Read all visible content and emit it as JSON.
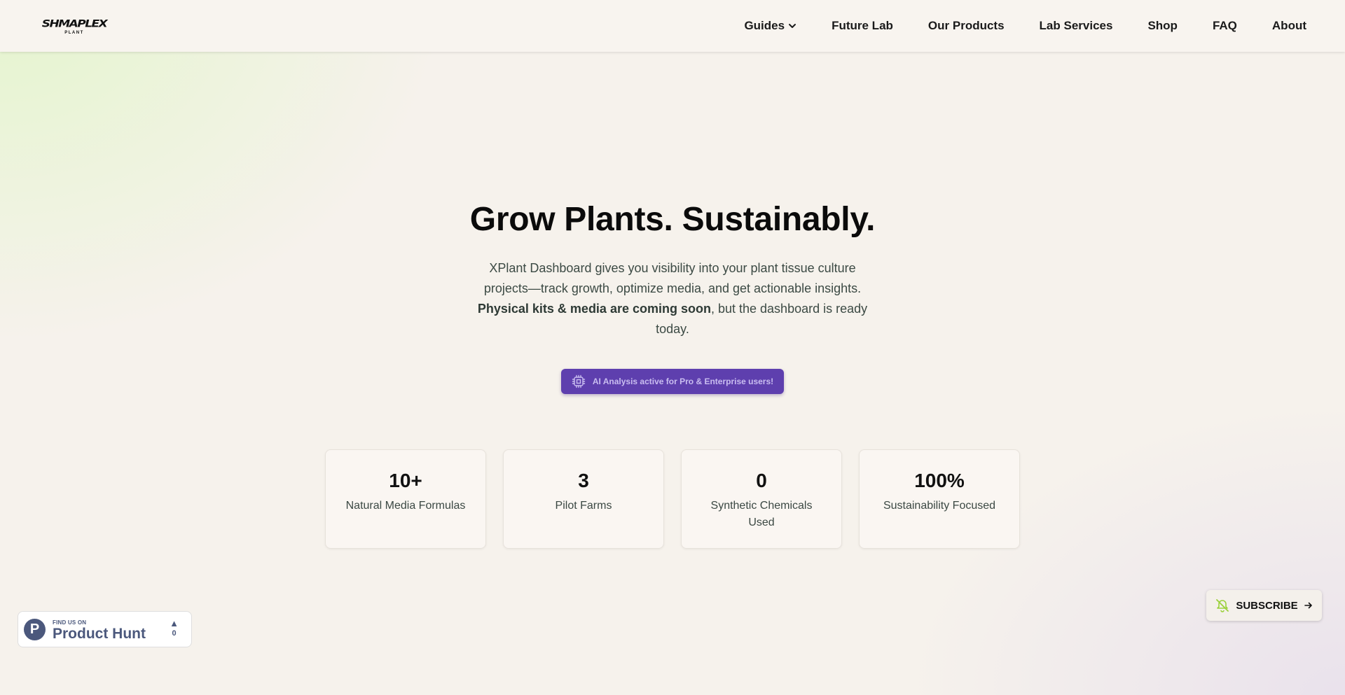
{
  "header": {
    "logo_text": "SHMAPLEX",
    "logo_subtext": "PLANT",
    "nav": [
      {
        "label": "Guides"
      },
      {
        "label": "Future Lab"
      },
      {
        "label": "Our Products"
      },
      {
        "label": "Lab Services"
      },
      {
        "label": "Shop"
      },
      {
        "label": "FAQ"
      },
      {
        "label": "About"
      }
    ]
  },
  "hero": {
    "title": "Grow Plants. Sustainably.",
    "desc_part1": "XPlant Dashboard gives you visibility into your plant tissue culture projects—track growth, optimize media, and get actionable insights. ",
    "desc_bold": "Physical kits & media are coming soon",
    "desc_part2": ", but the dashboard is ready today.",
    "ai_badge": "AI Analysis active for Pro & Enterprise users!"
  },
  "stats": [
    {
      "value": "10+",
      "label": "Natural Media Formulas"
    },
    {
      "value": "3",
      "label": "Pilot Farms"
    },
    {
      "value": "0",
      "label": "Synthetic Chemicals Used"
    },
    {
      "value": "100%",
      "label": "Sustainability Focused"
    }
  ],
  "subscribe": {
    "label": "SUBSCRIBE"
  },
  "product_hunt": {
    "logo_letter": "P",
    "small": "FIND US ON",
    "big": "Product Hunt",
    "votes": "0"
  },
  "colors": {
    "accent_purple": "#5e3fae",
    "product_hunt": "#4b587c",
    "subscribe_icon": "#9bd13a"
  }
}
